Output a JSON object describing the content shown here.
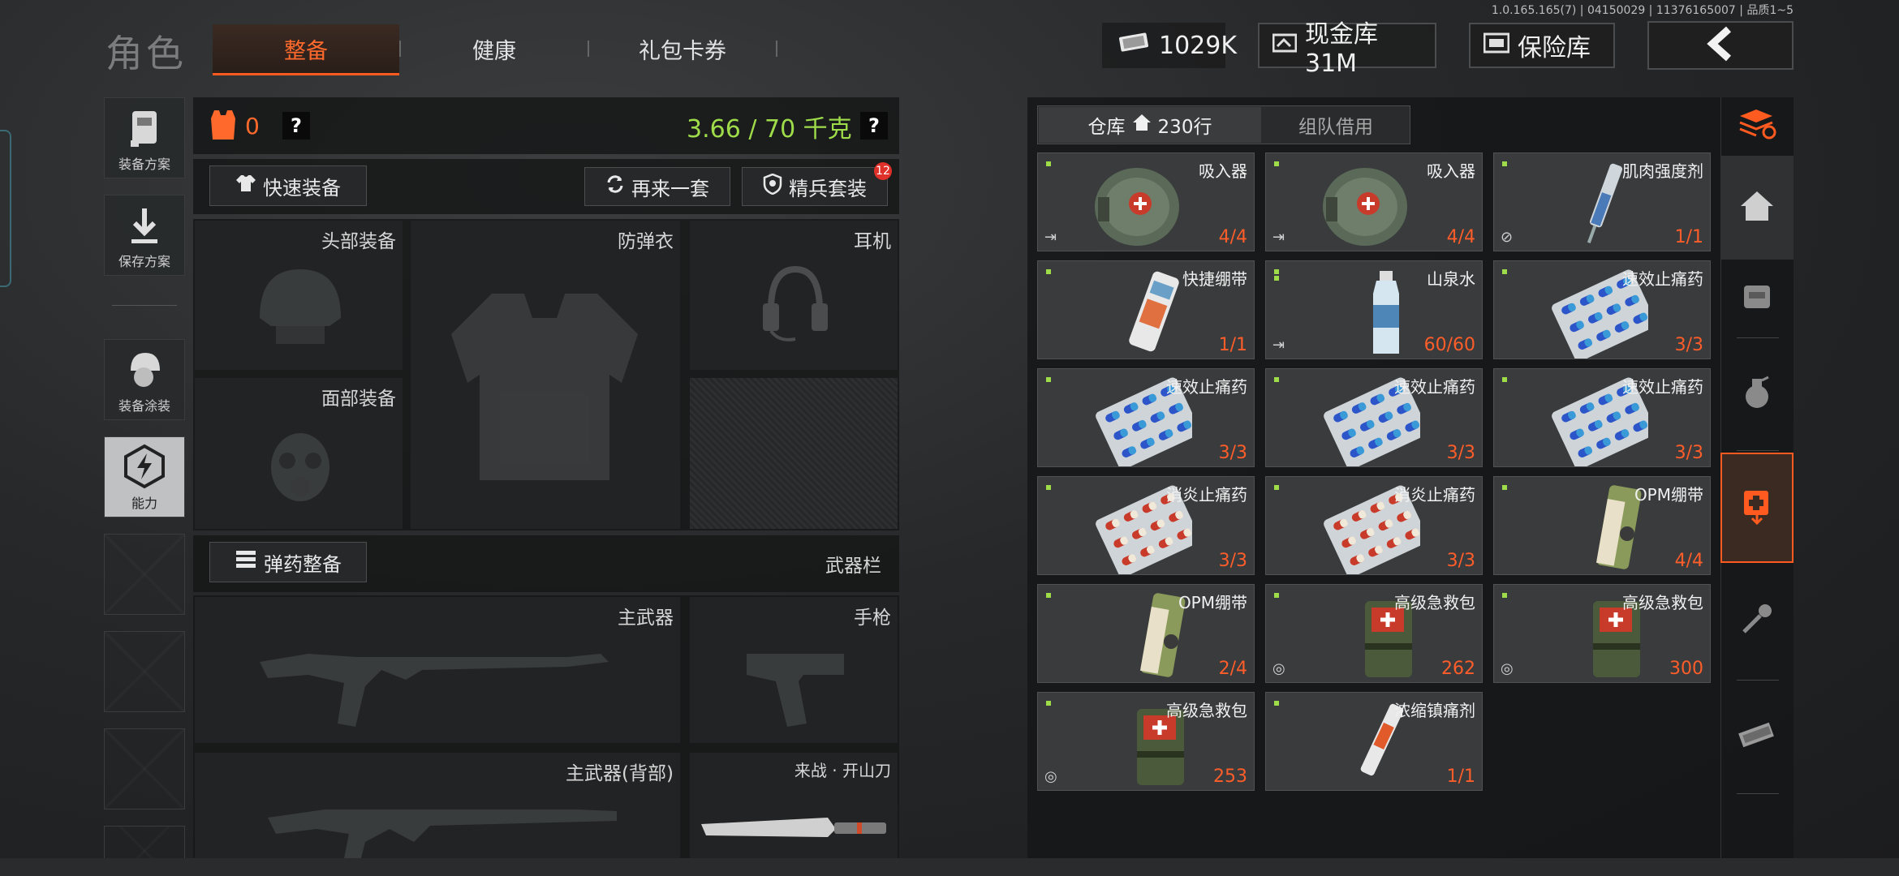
{
  "version": "1.0.165.165(7) | 04150029 | 11376165007 | 品质1~5",
  "header": {
    "title": "角色",
    "tabs": [
      {
        "label": "整备",
        "active": true
      },
      {
        "label": "健康",
        "active": false
      },
      {
        "label": "礼包卡券",
        "active": false
      }
    ],
    "currency": "1029K",
    "cash_vault": "现金库 31M",
    "safe": "保险库"
  },
  "sidebar": {
    "items": [
      {
        "label": "装备方案",
        "icon": "backpack-icon"
      },
      {
        "label": "保存方案",
        "icon": "download-icon"
      },
      {
        "label": "装备涂装",
        "icon": "helmet-paint-icon"
      },
      {
        "label": "能力",
        "icon": "ability-icon",
        "active": true
      }
    ]
  },
  "equipment": {
    "armor_count": "0",
    "help": "?",
    "weight": "3.66 / 70 千克",
    "quick_equip": "快速装备",
    "again": "再来一套",
    "elite_set": "精兵套装",
    "elite_badge": "12",
    "slots": {
      "head": "头部装备",
      "vest": "防弹衣",
      "headset": "耳机",
      "face": "面部装备",
      "primary": "主武器",
      "pistol": "手枪",
      "primary_back": "主武器(背部)",
      "melee": "来战 · 开山刀"
    },
    "ammo_btn": "弹药整备",
    "weapon_bar": "武器栏"
  },
  "warehouse": {
    "tab_label": "仓库",
    "rows": "230行",
    "team_tab": "组队借用",
    "items": [
      {
        "name": "吸入器",
        "count": "4/4",
        "corner": "⇥",
        "icon": "inhaler-icon"
      },
      {
        "name": "吸入器",
        "count": "4/4",
        "corner": "⇥",
        "icon": "inhaler-icon"
      },
      {
        "name": "肌肉强度剂",
        "count": "1/1",
        "corner": "⊘",
        "icon": "syringe-icon"
      },
      {
        "name": "快捷绷带",
        "count": "1/1",
        "corner": "",
        "icon": "bandage-icon"
      },
      {
        "name": "山泉水",
        "count": "60/60",
        "corner": "⇥",
        "icon": "water-bottle-icon",
        "double": true
      },
      {
        "name": "速效止痛药",
        "count": "3/3",
        "corner": "",
        "icon": "blue-pills-icon"
      },
      {
        "name": "速效止痛药",
        "count": "3/3",
        "corner": "",
        "icon": "blue-pills-icon"
      },
      {
        "name": "速效止痛药",
        "count": "3/3",
        "corner": "",
        "icon": "blue-pills-icon"
      },
      {
        "name": "速效止痛药",
        "count": "3/3",
        "corner": "",
        "icon": "blue-pills-icon"
      },
      {
        "name": "消炎止痛药",
        "count": "3/3",
        "corner": "",
        "icon": "red-pills-icon"
      },
      {
        "name": "消炎止痛药",
        "count": "3/3",
        "corner": "",
        "icon": "red-pills-icon"
      },
      {
        "name": "OPM绷带",
        "count": "4/4",
        "corner": "",
        "icon": "opm-bandage-icon"
      },
      {
        "name": "OPM绷带",
        "count": "2/4",
        "corner": "",
        "icon": "opm-bandage-icon"
      },
      {
        "name": "高级急救包",
        "count": "262",
        "corner": "◎",
        "icon": "medkit-icon"
      },
      {
        "name": "高级急救包",
        "count": "300",
        "corner": "◎",
        "icon": "medkit-icon"
      },
      {
        "name": "高级急救包",
        "count": "253",
        "corner": "◎",
        "icon": "medkit-icon"
      },
      {
        "name": "浓缩镇痛剂",
        "count": "1/1",
        "corner": "",
        "icon": "injector-icon"
      }
    ]
  },
  "colors": {
    "accent": "#ff5a1f",
    "weight_green": "#9fdc4a",
    "count_orange": "#ff5d2a"
  }
}
